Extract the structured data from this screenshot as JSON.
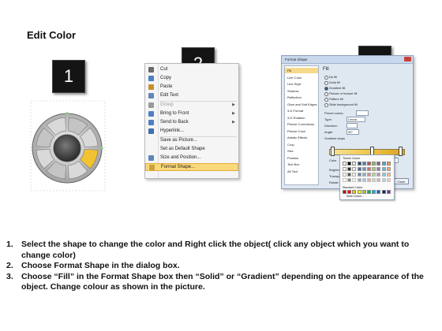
{
  "title": "Edit Color",
  "badges": [
    "1",
    "2",
    "3"
  ],
  "colors": {
    "badge_bg": "#141414",
    "highlight": "#fbd87a",
    "accent_segment": "#f2c230"
  },
  "context_menu": {
    "items": [
      {
        "label": "Cut",
        "icon": "scissors-icon"
      },
      {
        "label": "Copy",
        "icon": "copy-icon"
      },
      {
        "label": "Paste",
        "icon": "paste-icon"
      },
      {
        "label": "Edit Text",
        "icon": "edit-text-icon"
      },
      {
        "label": "Group",
        "icon": "group-icon",
        "disabled": true,
        "submenu": true
      },
      {
        "label": "Bring to Front",
        "icon": "bring-front-icon",
        "submenu": true
      },
      {
        "label": "Send to Back",
        "icon": "send-back-icon",
        "submenu": true
      },
      {
        "label": "Hyperlink...",
        "icon": "hyperlink-icon"
      },
      {
        "label": "Save as Picture...",
        "icon": ""
      },
      {
        "label": "Set as Default Shape",
        "icon": ""
      },
      {
        "label": "Size and Position...",
        "icon": "size-icon"
      },
      {
        "label": "Format Shape...",
        "icon": "format-shape-icon",
        "highlighted": true
      }
    ]
  },
  "format_dialog": {
    "title": "Format Shape",
    "nav": [
      "Fill",
      "Line Color",
      "Line Style",
      "Shadow",
      "Reflection",
      "Glow and Soft Edges",
      "3-D Format",
      "3-D Rotation",
      "Picture Corrections",
      "Picture Color",
      "Artistic Effects",
      "Crop",
      "Size",
      "Position",
      "Text Box",
      "Alt Text"
    ],
    "section": "Fill",
    "options": [
      "No fill",
      "Solid fill",
      "Gradient fill",
      "Picture or texture fill",
      "Pattern fill",
      "Slide background fill"
    ],
    "labels": {
      "preset": "Preset colors:",
      "type": "Type:",
      "type_value": "Linear",
      "direction": "Direction:",
      "angle": "Angle:",
      "angle_value": "90°",
      "stops": "Gradient stops",
      "color": "Color",
      "position": "Position:",
      "position_value": "61%",
      "brightness": "Brightness:",
      "transparency": "Transparency:",
      "rotate": "Rotate with shape",
      "theme_colors": "Theme Colors",
      "standard_colors": "Standard Colors",
      "more_colors": "More Colors...",
      "close": "Close"
    }
  },
  "instructions": [
    {
      "num": "1.",
      "text": "Select the shape to change the color and Right click the object( click any object which you want to change color)"
    },
    {
      "num": "2.",
      "text": "Choose Format Shape in the dialog box."
    },
    {
      "num": "3.",
      "text": "Choose “Fill” in the Format Shape box then “Solid” or “Gradient” depending on the appearance of the object. Change colour as shown in the picture."
    }
  ]
}
